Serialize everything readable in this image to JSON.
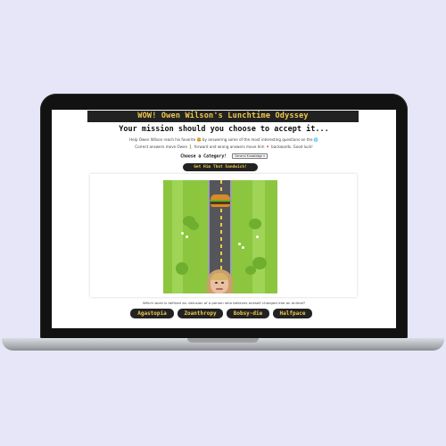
{
  "app": {
    "title": "WOW! Owen Wilson's Lunchtime Odyssey"
  },
  "header": {
    "mission": "Your mission should you choose to accept it...",
    "line1": "Help Owen Wilson reach his favorite 🍔 by answering some of the most interesting questions on the 🌐",
    "line2": "Correct answers move Owen 🚶 forward and wrong answers move him 🔻 backwards. Good luck!"
  },
  "category": {
    "label": "Choose a Category!",
    "selected": "General Knowledge"
  },
  "start_button": {
    "label": "Get Him That Sandwich!"
  },
  "quiz": {
    "question": "Which word is defined as: delusion of a person who believes oneself changed into an animal?",
    "answers": [
      "Agastopia",
      "Zoanthropy",
      "Bobsy-die",
      "Halfpace"
    ]
  },
  "colors": {
    "accent": "#f2c94c",
    "dark": "#222222",
    "grass": "#8cc63f",
    "road": "#55565a"
  },
  "icons": {
    "goal": "burger-icon",
    "player": "owen-wilson-face"
  }
}
